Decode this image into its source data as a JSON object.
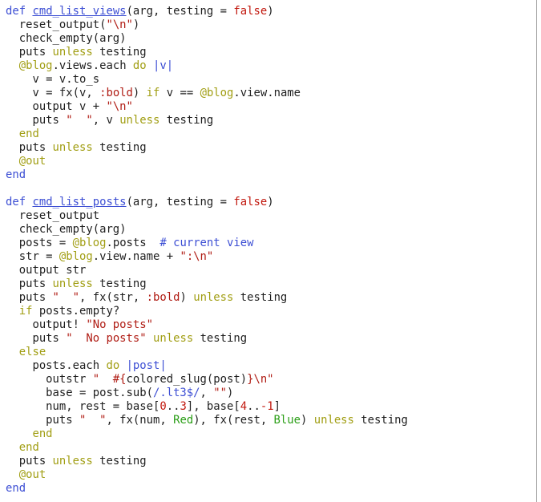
{
  "colors": {
    "text": "#1f1f1f",
    "keyword": "#3d4fd4",
    "modifier": "#a19e13",
    "ivar": "#a19e13",
    "string": "#b01c14",
    "symbol": "#b01c14",
    "literal": "#c2190f",
    "number": "#c2190f",
    "comment": "#3d4fd4",
    "red_const": "#b01c14",
    "blue_const": "#2f49c9",
    "green_const": "#2a9e16"
  },
  "code_lines": [
    [
      {
        "t": "def",
        "c": "keyword"
      },
      {
        "t": " "
      },
      {
        "t": "cmd_list_views",
        "c": "keyword",
        "u": true
      },
      {
        "t": "(arg, testing = "
      },
      {
        "t": "false",
        "c": "literal"
      },
      {
        "t": ")"
      }
    ],
    [
      {
        "t": "  reset_output("
      },
      {
        "t": "\"\\n\"",
        "c": "string"
      },
      {
        "t": ")"
      }
    ],
    [
      {
        "t": "  check_empty(arg)"
      }
    ],
    [
      {
        "t": "  puts "
      },
      {
        "t": "unless",
        "c": "modifier"
      },
      {
        "t": " testing"
      }
    ],
    [
      {
        "t": "  "
      },
      {
        "t": "@blog",
        "c": "ivar"
      },
      {
        "t": ".views.each "
      },
      {
        "t": "do",
        "c": "modifier"
      },
      {
        "t": " "
      },
      {
        "t": "|v|",
        "c": "keyword"
      }
    ],
    [
      {
        "t": "    v = v.to_s"
      }
    ],
    [
      {
        "t": "    v = fx(v, "
      },
      {
        "t": ":bold",
        "c": "symbol"
      },
      {
        "t": ") "
      },
      {
        "t": "if",
        "c": "modifier"
      },
      {
        "t": " v == "
      },
      {
        "t": "@blog",
        "c": "ivar"
      },
      {
        "t": ".view.name"
      }
    ],
    [
      {
        "t": "    output v + "
      },
      {
        "t": "\"\\n\"",
        "c": "string"
      }
    ],
    [
      {
        "t": "    puts "
      },
      {
        "t": "\"  \"",
        "c": "string"
      },
      {
        "t": ", v "
      },
      {
        "t": "unless",
        "c": "modifier"
      },
      {
        "t": " testing"
      }
    ],
    [
      {
        "t": "  "
      },
      {
        "t": "end",
        "c": "modifier"
      }
    ],
    [
      {
        "t": "  puts "
      },
      {
        "t": "unless",
        "c": "modifier"
      },
      {
        "t": " testing"
      }
    ],
    [
      {
        "t": "  "
      },
      {
        "t": "@out",
        "c": "ivar"
      }
    ],
    [
      {
        "t": "end",
        "c": "keyword"
      }
    ],
    [
      {
        "t": ""
      }
    ],
    [
      {
        "t": "def",
        "c": "keyword"
      },
      {
        "t": " "
      },
      {
        "t": "cmd_list_posts",
        "c": "keyword",
        "u": true
      },
      {
        "t": "(arg, testing = "
      },
      {
        "t": "false",
        "c": "literal"
      },
      {
        "t": ")"
      }
    ],
    [
      {
        "t": "  reset_output"
      }
    ],
    [
      {
        "t": "  check_empty(arg)"
      }
    ],
    [
      {
        "t": "  posts = "
      },
      {
        "t": "@blog",
        "c": "ivar"
      },
      {
        "t": ".posts  "
      },
      {
        "t": "# current view",
        "c": "comment"
      }
    ],
    [
      {
        "t": "  str = "
      },
      {
        "t": "@blog",
        "c": "ivar"
      },
      {
        "t": ".view.name + "
      },
      {
        "t": "\":\\n\"",
        "c": "string"
      }
    ],
    [
      {
        "t": "  output str"
      }
    ],
    [
      {
        "t": "  puts "
      },
      {
        "t": "unless",
        "c": "modifier"
      },
      {
        "t": " testing"
      }
    ],
    [
      {
        "t": "  puts "
      },
      {
        "t": "\"  \"",
        "c": "string"
      },
      {
        "t": ", fx(str, "
      },
      {
        "t": ":bold",
        "c": "symbol"
      },
      {
        "t": ") "
      },
      {
        "t": "unless",
        "c": "modifier"
      },
      {
        "t": " testing"
      }
    ],
    [
      {
        "t": "  "
      },
      {
        "t": "if",
        "c": "modifier"
      },
      {
        "t": " posts.empty?"
      }
    ],
    [
      {
        "t": "    output! "
      },
      {
        "t": "\"No posts\"",
        "c": "string"
      }
    ],
    [
      {
        "t": "    puts "
      },
      {
        "t": "\"  No posts\"",
        "c": "string"
      },
      {
        "t": " "
      },
      {
        "t": "unless",
        "c": "modifier"
      },
      {
        "t": " testing"
      }
    ],
    [
      {
        "t": "  "
      },
      {
        "t": "else",
        "c": "modifier"
      }
    ],
    [
      {
        "t": "    posts.each "
      },
      {
        "t": "do",
        "c": "modifier"
      },
      {
        "t": " "
      },
      {
        "t": "|post|",
        "c": "keyword"
      }
    ],
    [
      {
        "t": "      outstr "
      },
      {
        "t": "\"  #{",
        "c": "string"
      },
      {
        "t": "colored_slug(post)"
      },
      {
        "t": "}\\n\"",
        "c": "string"
      }
    ],
    [
      {
        "t": "      base = post.sub("
      },
      {
        "t": "/.lt3$/",
        "c": "keyword"
      },
      {
        "t": ", "
      },
      {
        "t": "\"\"",
        "c": "string"
      },
      {
        "t": ")"
      }
    ],
    [
      {
        "t": "      num, rest = base["
      },
      {
        "t": "0",
        "c": "number"
      },
      {
        "t": ".."
      },
      {
        "t": "3",
        "c": "number"
      },
      {
        "t": "], base["
      },
      {
        "t": "4",
        "c": "number"
      },
      {
        "t": ".."
      },
      {
        "t": "-1",
        "c": "number"
      },
      {
        "t": "]"
      }
    ],
    [
      {
        "t": "      puts "
      },
      {
        "t": "\"  \"",
        "c": "string"
      },
      {
        "t": ", fx(num, "
      },
      {
        "t": "Red",
        "c": "green_const"
      },
      {
        "t": "), fx(rest, "
      },
      {
        "t": "Blue",
        "c": "green_const"
      },
      {
        "t": ") "
      },
      {
        "t": "unless",
        "c": "modifier"
      },
      {
        "t": " testing"
      }
    ],
    [
      {
        "t": "    "
      },
      {
        "t": "end",
        "c": "modifier"
      }
    ],
    [
      {
        "t": "  "
      },
      {
        "t": "end",
        "c": "modifier"
      }
    ],
    [
      {
        "t": "  puts "
      },
      {
        "t": "unless",
        "c": "modifier"
      },
      {
        "t": " testing"
      }
    ],
    [
      {
        "t": "  "
      },
      {
        "t": "@out",
        "c": "ivar"
      }
    ],
    [
      {
        "t": "end",
        "c": "keyword"
      }
    ]
  ]
}
